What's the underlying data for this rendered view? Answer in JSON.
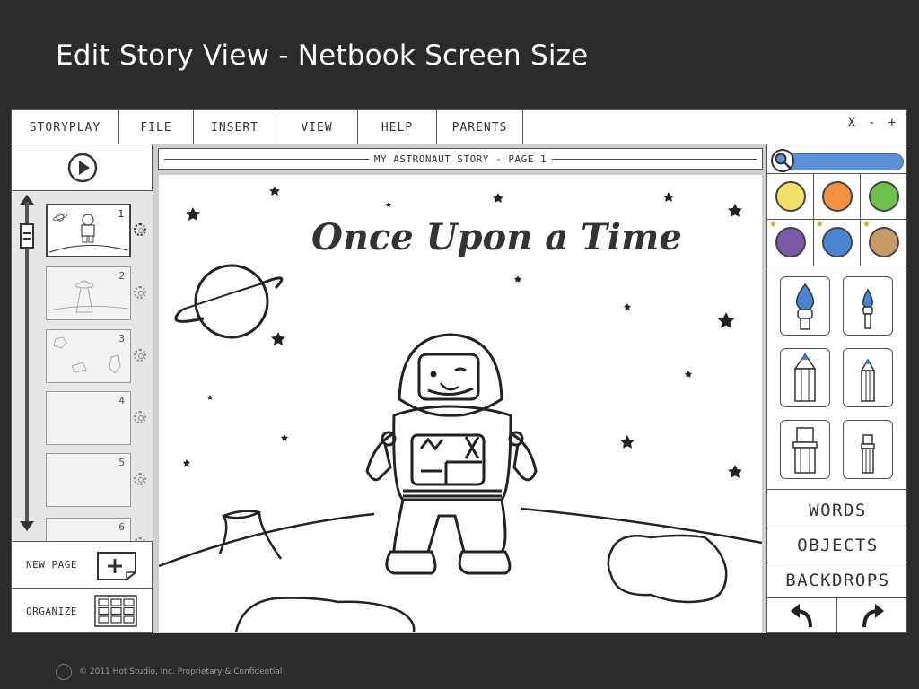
{
  "slide": {
    "title": "Edit Story View - Netbook Screen Size"
  },
  "menu": {
    "items": [
      {
        "label": "STORYPLAY"
      },
      {
        "label": "FILE"
      },
      {
        "label": "INSERT"
      },
      {
        "label": "VIEW"
      },
      {
        "label": "HELP"
      },
      {
        "label": "PARENTS"
      }
    ],
    "window_controls": {
      "close": "X",
      "minimize": "-",
      "maximize": "+"
    }
  },
  "left_panel": {
    "pages": [
      {
        "number": "1",
        "active": true
      },
      {
        "number": "2",
        "active": false
      },
      {
        "number": "3",
        "active": false
      },
      {
        "number": "4",
        "active": false
      },
      {
        "number": "5",
        "active": false
      },
      {
        "number": "6",
        "active": false
      }
    ],
    "new_page_label": "NEW PAGE",
    "organize_label": "ORGANIZE"
  },
  "canvas": {
    "story_title": "MY ASTRONAUT STORY - PAGE 1",
    "heading": "Once Upon a Time"
  },
  "right_panel": {
    "colors": [
      {
        "name": "yellow",
        "hex": "#f2e06b",
        "starred": false
      },
      {
        "name": "orange",
        "hex": "#f2913e",
        "starred": false
      },
      {
        "name": "green",
        "hex": "#6cc24a",
        "starred": false
      },
      {
        "name": "purple",
        "hex": "#7a5aa8",
        "starred": true
      },
      {
        "name": "blue",
        "hex": "#4a86cf",
        "starred": true
      },
      {
        "name": "tan",
        "hex": "#c79a68",
        "starred": true
      }
    ],
    "tools": [
      "large-paintbrush-icon",
      "small-paintbrush-icon",
      "large-pencil-icon",
      "small-pencil-icon",
      "large-eraser-icon",
      "small-eraser-icon"
    ],
    "words_label": "WORDS",
    "objects_label": "OBJECTS",
    "backdrops_label": "BACKDROPS"
  },
  "footer": {
    "text": "© 2011 Hot Studio, Inc. Proprietary & Confidential"
  }
}
